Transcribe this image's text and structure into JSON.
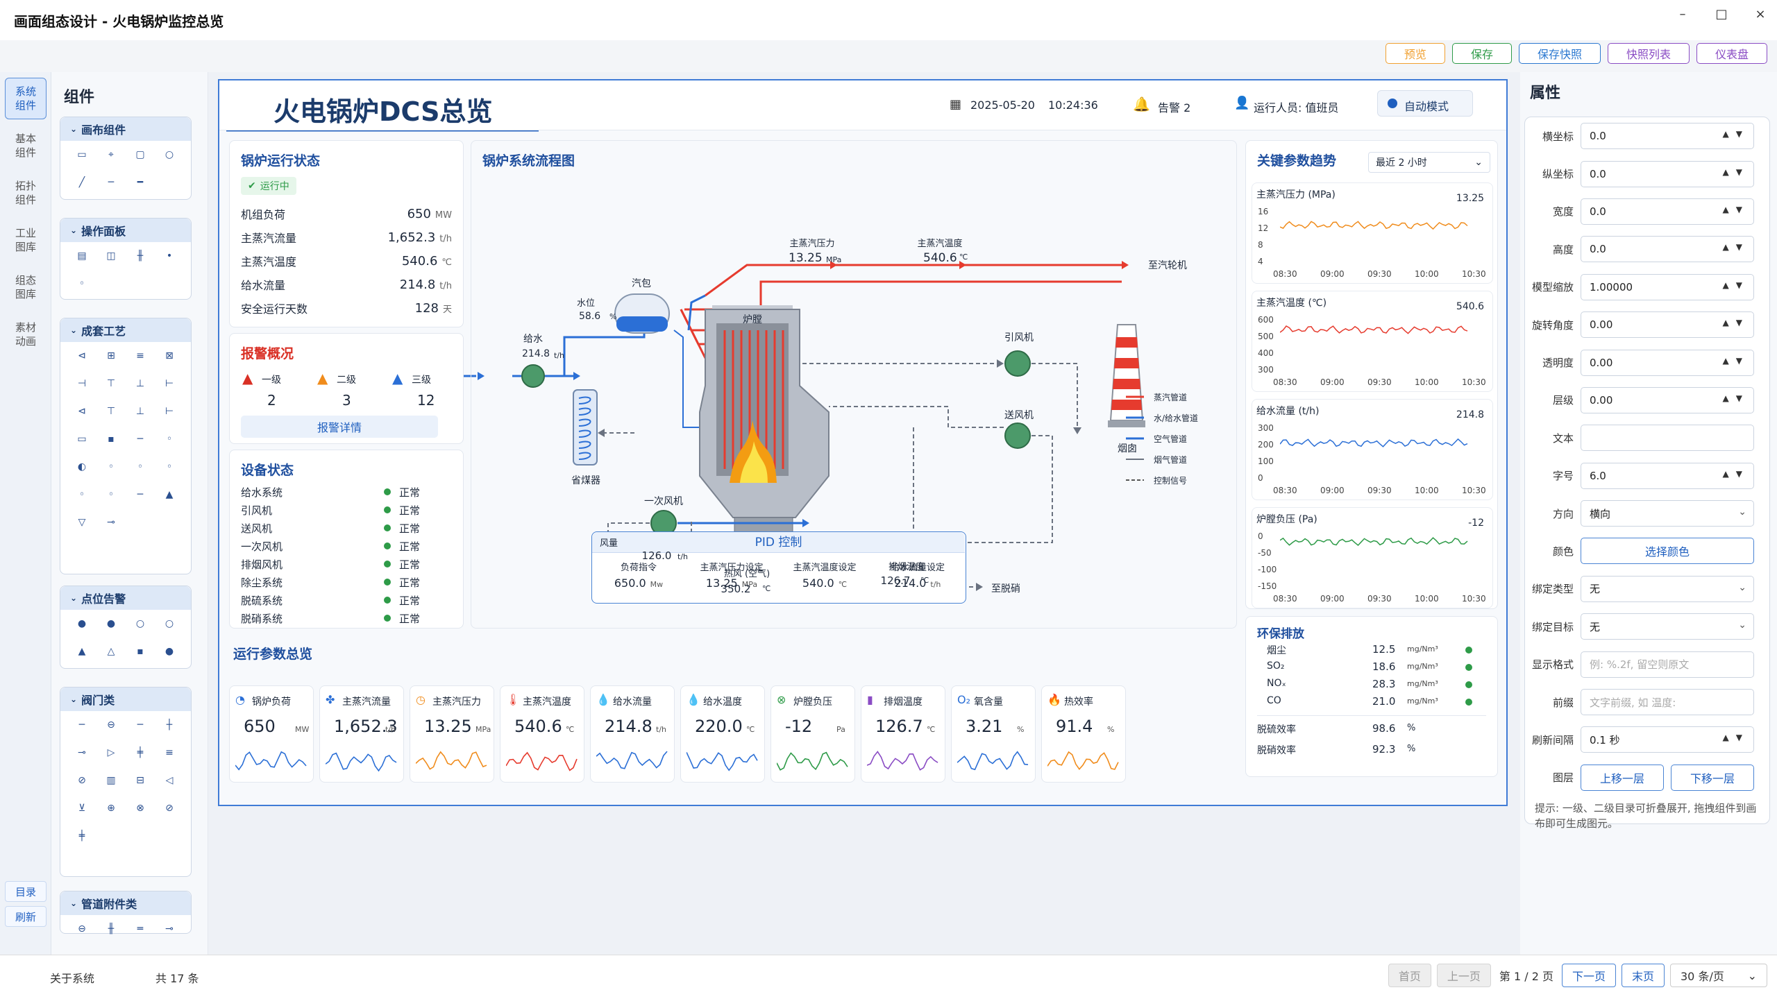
{
  "window": {
    "title": "画面组态设计 - 火电锅炉监控总览",
    "min": "–",
    "max": "□",
    "close": "×"
  },
  "toolbar": [
    {
      "label": "预览",
      "color": "#f0a030"
    },
    {
      "label": "保存",
      "color": "#2e9b48"
    },
    {
      "label": "保存快照",
      "color": "#2b78d0"
    },
    {
      "label": "快照列表",
      "color": "#8a4cc4"
    },
    {
      "label": "仪表盘",
      "color": "#8a4cc4"
    }
  ],
  "rail": {
    "items": [
      "系统组件",
      "基本组件",
      "拓扑组件",
      "工业图库",
      "组态图库",
      "素材动画"
    ],
    "bottom": [
      "目录",
      "刷新"
    ]
  },
  "palette": {
    "title": "组件",
    "groups": [
      {
        "label": "画布组件",
        "icons": [
          "▭",
          "⌖",
          "▢",
          "○",
          "╱",
          "─",
          "━"
        ]
      },
      {
        "label": "操作面板",
        "icons": [
          "▤",
          "◫",
          "╫",
          "•",
          "◦"
        ]
      },
      {
        "label": "成套工艺",
        "icons": [
          "⊲",
          "⊞",
          "≡",
          "⊠",
          "⊣",
          "⊤",
          "⊥",
          "⊢",
          "⊲",
          "⊤",
          "⊥",
          "⊢",
          "▭",
          "▪",
          "─",
          "◦",
          "◐",
          "◦",
          "◦",
          "◦",
          "◦",
          "◦",
          "─",
          "▲",
          "▽",
          "⊸"
        ]
      },
      {
        "label": "点位告警",
        "icons": [
          "●",
          "●",
          "○",
          "○",
          "▲",
          "△",
          "▪",
          "●"
        ]
      },
      {
        "label": "阀门类",
        "icons": [
          "─",
          "⊖",
          "─",
          "┼",
          "⊸",
          "▷",
          "╪",
          "≡",
          "⊘",
          "▥",
          "⊟",
          "◁",
          "⊻",
          "⊕",
          "⊗",
          "⊘",
          "╪"
        ]
      },
      {
        "label": "管道附件类",
        "icons": [
          "⊖",
          "╫",
          "═",
          "⊸"
        ]
      }
    ]
  },
  "dashboard": {
    "title": "火电锅炉DCS总览",
    "date": "2025-05-20",
    "time": "10:24:36",
    "alarm_label": "告警 2",
    "operator": "运行人员: 值班员",
    "mode": "自动模式",
    "status_card": {
      "title": "锅炉运行状态",
      "badge": "运行中",
      "rows": [
        {
          "k": "机组负荷",
          "v": "650",
          "u": "MW"
        },
        {
          "k": "主蒸汽流量",
          "v": "1,652.3",
          "u": "t/h"
        },
        {
          "k": "主蒸汽温度",
          "v": "540.6",
          "u": "℃"
        },
        {
          "k": "给水流量",
          "v": "214.8",
          "u": "t/h"
        },
        {
          "k": "安全运行天数",
          "v": "128",
          "u": "天"
        }
      ]
    },
    "alarm_card": {
      "title": "报警概况",
      "levels": [
        {
          "label": "一级",
          "count": "2",
          "color": "#d93025"
        },
        {
          "label": "二级",
          "count": "3",
          "color": "#f08c1c"
        },
        {
          "label": "三级",
          "count": "12",
          "color": "#2b6fd6"
        }
      ],
      "detail": "报警详情"
    },
    "equip_card": {
      "title": "设备状态",
      "rows": [
        {
          "k": "给水系统",
          "v": "正常"
        },
        {
          "k": "引风机",
          "v": "正常"
        },
        {
          "k": "送风机",
          "v": "正常"
        },
        {
          "k": "一次风机",
          "v": "正常"
        },
        {
          "k": "排烟风机",
          "v": "正常"
        },
        {
          "k": "除尘系统",
          "v": "正常"
        },
        {
          "k": "脱硫系统",
          "v": "正常"
        },
        {
          "k": "脱硝系统",
          "v": "正常"
        }
      ]
    },
    "flow": {
      "title": "锅炉系统流程图",
      "drum": "汽包",
      "level_label": "水位",
      "level_value": "58.6",
      "level_unit": "%",
      "furnace": "炉膛",
      "feed_label": "给水",
      "feed_value": "214.8",
      "feed_unit": "t/h",
      "econ": "省煤器",
      "pa_fan": "一次风机",
      "air_label": "风量",
      "air_value": "126.0",
      "air_unit": "t/h",
      "hot_air_label": "热风 (空气)",
      "hot_air_value": "350.2",
      "hot_air_unit": "℃",
      "exhaust_label": "排烟温度",
      "exhaust_value": "126.7",
      "exhaust_unit": "℃",
      "steam_p_label": "主蒸汽压力",
      "steam_p_value": "13.25",
      "steam_p_unit": "MPa",
      "steam_t_label": "主蒸汽温度",
      "steam_t_value": "540.6",
      "steam_t_unit": "℃",
      "to_turbine": "至汽轮机",
      "id_fan": "引风机",
      "fd_fan": "送风机",
      "chimney": "烟囱",
      "to_denox": "至脱硝",
      "legend": [
        {
          "label": "蒸汽管道",
          "color": "#e63b2e",
          "style": "solid"
        },
        {
          "label": "水/给水管道",
          "color": "#2b6fd6",
          "style": "solid"
        },
        {
          "label": "空气管道",
          "color": "#2b6fd6",
          "style": "solid"
        },
        {
          "label": "烟气管道",
          "color": "#555555",
          "style": "dashed"
        },
        {
          "label": "控制信号",
          "color": "#555555",
          "style": "dashed"
        }
      ]
    },
    "pid": {
      "title": "PID 控制",
      "items": [
        {
          "k": "负荷指令",
          "v": "650.0",
          "u": "Mw"
        },
        {
          "k": "主蒸汽压力设定",
          "v": "13.25",
          "u": "MPa"
        },
        {
          "k": "主蒸汽温度设定",
          "v": "540.0",
          "u": "℃"
        },
        {
          "k": "给水流量设定",
          "v": "214.0",
          "u": "t/h"
        }
      ]
    },
    "overview": {
      "title": "运行参数总览",
      "items": [
        {
          "k": "锅炉负荷",
          "v": "650",
          "u": "MW",
          "color": "#2b6fd6",
          "icon": "gauge-icon"
        },
        {
          "k": "主蒸汽流量",
          "v": "1,652.3",
          "u": "t/h",
          "color": "#2b6fd6",
          "icon": "molecule-icon"
        },
        {
          "k": "主蒸汽压力",
          "v": "13.25",
          "u": "MPa",
          "color": "#f08c1c",
          "icon": "pressure-gauge-icon"
        },
        {
          "k": "主蒸汽温度",
          "v": "540.6",
          "u": "℃",
          "color": "#e63b2e",
          "icon": "thermometer-icon"
        },
        {
          "k": "给水流量",
          "v": "214.8",
          "u": "t/h",
          "color": "#2b6fd6",
          "icon": "water-drop-icon"
        },
        {
          "k": "给水温度",
          "v": "220.0",
          "u": "℃",
          "color": "#2b6fd6",
          "icon": "water-temp-icon"
        },
        {
          "k": "炉膛负压",
          "v": "-12",
          "u": "Pa",
          "color": "#2e9b48",
          "icon": "fan-icon"
        },
        {
          "k": "排烟温度",
          "v": "126.7",
          "u": "℃",
          "color": "#8a4cc4",
          "icon": "chimney-icon"
        },
        {
          "k": "氧含量",
          "v": "3.21",
          "u": "%",
          "color": "#2b6fd6",
          "icon": "oxygen-icon"
        },
        {
          "k": "热效率",
          "v": "91.4",
          "u": "%",
          "color": "#f08c1c",
          "icon": "flame-icon"
        }
      ]
    },
    "trends": {
      "title": "关键参数趋势",
      "range": "最近 2 小时",
      "xticks": [
        "08:30",
        "09:00",
        "09:30",
        "10:00",
        "10:30"
      ],
      "charts": [
        {
          "name": "主蒸汽压力 (MPa)",
          "current": "13.25",
          "ticks": [
            "16",
            "12",
            "8",
            "4"
          ],
          "color": "#f08c1c",
          "ylim": [
            4,
            16
          ],
          "level": 12.9
        },
        {
          "name": "主蒸汽温度 (℃)",
          "current": "540.6",
          "ticks": [
            "600",
            "500",
            "400",
            "300"
          ],
          "color": "#e63b2e",
          "ylim": [
            300,
            600
          ],
          "level": 545
        },
        {
          "name": "给水流量 (t/h)",
          "current": "214.8",
          "ticks": [
            "300",
            "200",
            "100",
            "0"
          ],
          "color": "#2b6fd6",
          "ylim": [
            0,
            300
          ],
          "level": 215
        },
        {
          "name": "炉膛负压 (Pa)",
          "current": "-12",
          "ticks": [
            "0",
            "-50",
            "-100",
            "-150"
          ],
          "color": "#2e9b48",
          "ylim": [
            -150,
            0
          ],
          "level": -14
        }
      ]
    },
    "emission": {
      "title": "环保排放",
      "rows": [
        {
          "k": "烟尘",
          "v": "12.5",
          "u": "mg/Nm³"
        },
        {
          "k": "SO₂",
          "v": "18.6",
          "u": "mg/Nm³"
        },
        {
          "k": "NOₓ",
          "v": "28.3",
          "u": "mg/Nm³"
        },
        {
          "k": "CO",
          "v": "21.0",
          "u": "mg/Nm³"
        }
      ],
      "eff": [
        {
          "k": "脱硫效率",
          "v": "98.6",
          "u": "%"
        },
        {
          "k": "脱硝效率",
          "v": "92.3",
          "u": "%"
        }
      ]
    }
  },
  "properties": {
    "title": "属性",
    "rows": [
      {
        "k": "横坐标",
        "v": "0.0",
        "type": "spin"
      },
      {
        "k": "纵坐标",
        "v": "0.0",
        "type": "spin"
      },
      {
        "k": "宽度",
        "v": "0.0",
        "type": "spin"
      },
      {
        "k": "高度",
        "v": "0.0",
        "type": "spin"
      },
      {
        "k": "模型缩放",
        "v": "1.00000",
        "type": "spin"
      },
      {
        "k": "旋转角度",
        "v": "0.00",
        "type": "spin"
      },
      {
        "k": "透明度",
        "v": "0.00",
        "type": "spin"
      },
      {
        "k": "层级",
        "v": "0.00",
        "type": "spin"
      },
      {
        "k": "文本",
        "v": "",
        "type": "text"
      },
      {
        "k": "字号",
        "v": "6.0",
        "type": "spin"
      },
      {
        "k": "方向",
        "v": "横向",
        "type": "select"
      },
      {
        "k": "颜色",
        "v": "选择颜色",
        "type": "color"
      },
      {
        "k": "绑定类型",
        "v": "无",
        "type": "select"
      },
      {
        "k": "绑定目标",
        "v": "无",
        "type": "select"
      },
      {
        "k": "显示格式",
        "v": "例: %.2f, 留空则原文",
        "type": "placeholder"
      },
      {
        "k": "前缀",
        "v": "文字前缀, 如 温度:",
        "type": "placeholder"
      },
      {
        "k": "刷新间隔",
        "v": "0.1 秒",
        "type": "spin"
      }
    ],
    "layer": {
      "k": "图层",
      "up": "上移一层",
      "down": "下移一层"
    },
    "hint": "提示: 一级、二级目录可折叠展开, 拖拽组件到画布即可生成图元。"
  },
  "statusbar": {
    "about": "关于系统",
    "count": "共 17 条",
    "first": "首页",
    "prev": "上一页",
    "page": "第 1 / 2 页",
    "next": "下一页",
    "last": "末页",
    "per_page": "30 条/页"
  }
}
